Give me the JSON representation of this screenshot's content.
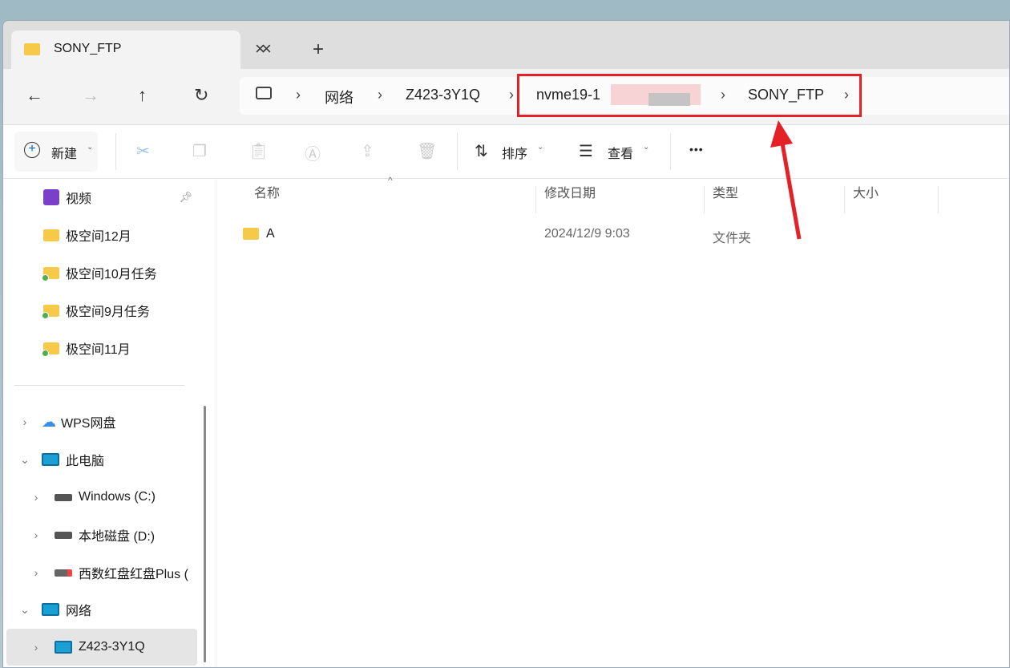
{
  "tab": {
    "title": "SONY_FTP",
    "close": "×",
    "new": "+"
  },
  "nav": {
    "back": "←",
    "forward": "→",
    "up": "↑",
    "refresh": "↻"
  },
  "breadcrumb": [
    "网络",
    "Z423-3Y1Q",
    "nvme19-1",
    "SONY_FTP"
  ],
  "toolbar": {
    "new_label": "新建",
    "sort_label": "排序",
    "view_label": "查看",
    "more": "•••"
  },
  "sidebar": {
    "quick": [
      {
        "label": "视频",
        "icon": "video"
      },
      {
        "label": "极空间12月",
        "icon": "folder"
      },
      {
        "label": "极空间10月任务",
        "icon": "folder-sync"
      },
      {
        "label": "极空间9月任务",
        "icon": "folder-sync"
      },
      {
        "label": "极空间11月",
        "icon": "folder-sync"
      }
    ],
    "wps": "WPS网盘",
    "pc": "此电脑",
    "drives": [
      "Windows (C:)",
      "本地磁盘 (D:)",
      "西数红盘红盘Plus ("
    ],
    "network": "网络",
    "host": "Z423-3Y1Q"
  },
  "columns": [
    "名称",
    "修改日期",
    "类型",
    "大小"
  ],
  "files": [
    {
      "name": "A",
      "modified": "2024/12/9 9:03",
      "type": "文件夹",
      "size": ""
    }
  ],
  "colors": {
    "highlight": "#e32127",
    "accent": "#0067c0"
  }
}
